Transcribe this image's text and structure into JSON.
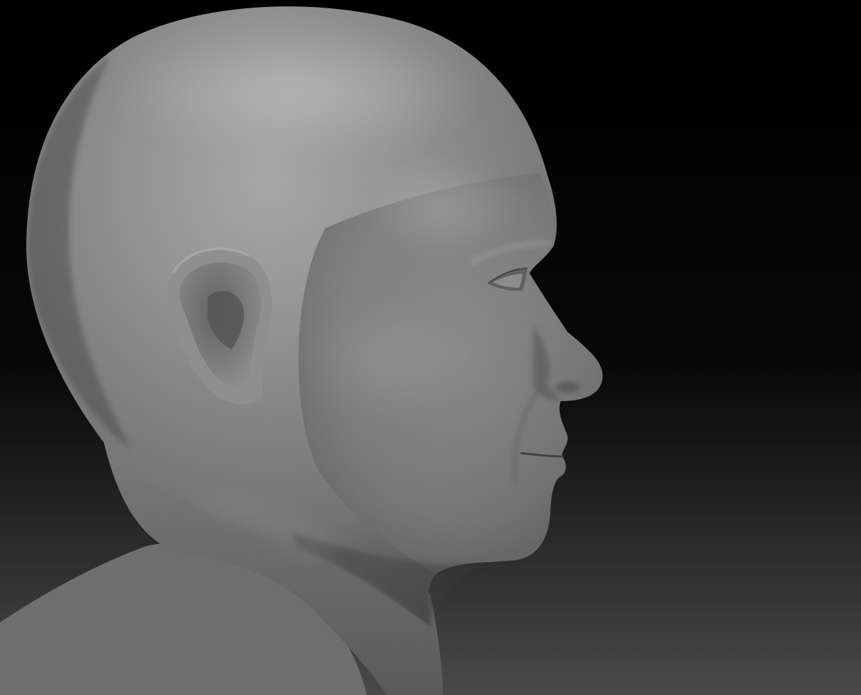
{
  "scene": {
    "subject": "sculpt-head-profile",
    "view": "right-profile",
    "colors": {
      "background_top": "#000000",
      "background_mid": "#0a0a0a",
      "background_bottom": "#4a4a4a",
      "clay_highlight": "#a9a9a9",
      "clay_base": "#7e7e7e",
      "clay_shadow": "#4e4e4e",
      "clay_deep_shadow": "#343434"
    }
  }
}
